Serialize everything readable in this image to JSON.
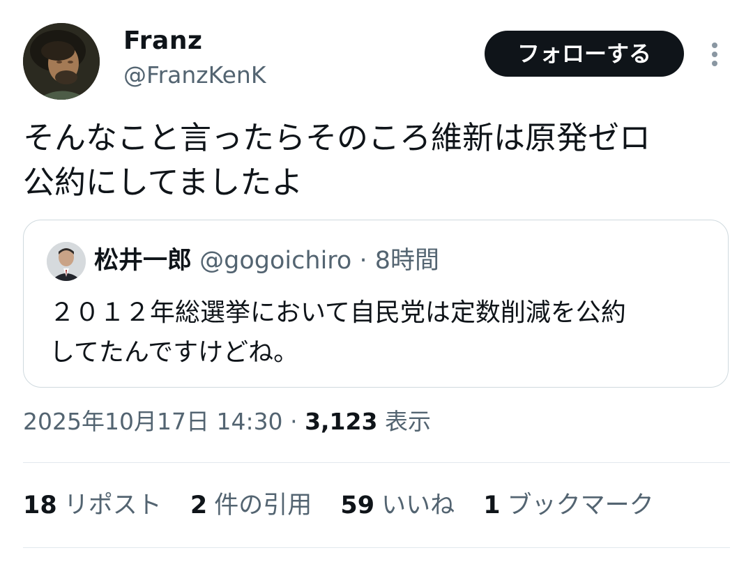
{
  "author": {
    "display_name": "Franz",
    "handle": "@FranzKenK",
    "avatar_icon": "portrait-avatar"
  },
  "follow_button_label": "フォローする",
  "more_icon": "more-options-icon",
  "tweet": {
    "text_lines": [
      "そんなこと言ったらそのころ維新は原発ゼロ",
      "公約にしてましたよ"
    ]
  },
  "quoted_tweet": {
    "display_name": "松井一郎",
    "handle": "@gogoichiro",
    "separator": "·",
    "time": "8時間",
    "text_lines": [
      "２０１２年総選挙において自民党は定数削減を公約",
      "してたんですけどね。"
    ]
  },
  "meta": {
    "timestamp": "2025年10月17日 14:30",
    "separator": "·",
    "views_count": "3,123",
    "views_label": "表示"
  },
  "stats": [
    {
      "count": "18",
      "label": "リポスト"
    },
    {
      "count": "2",
      "label": "件の引用"
    },
    {
      "count": "59",
      "label": "いいね"
    },
    {
      "count": "1",
      "label": "ブックマーク"
    }
  ],
  "colors": {
    "text_primary": "#0f1419",
    "text_secondary": "#536471",
    "border": "#cfd9de",
    "button_bg": "#0f1419"
  }
}
